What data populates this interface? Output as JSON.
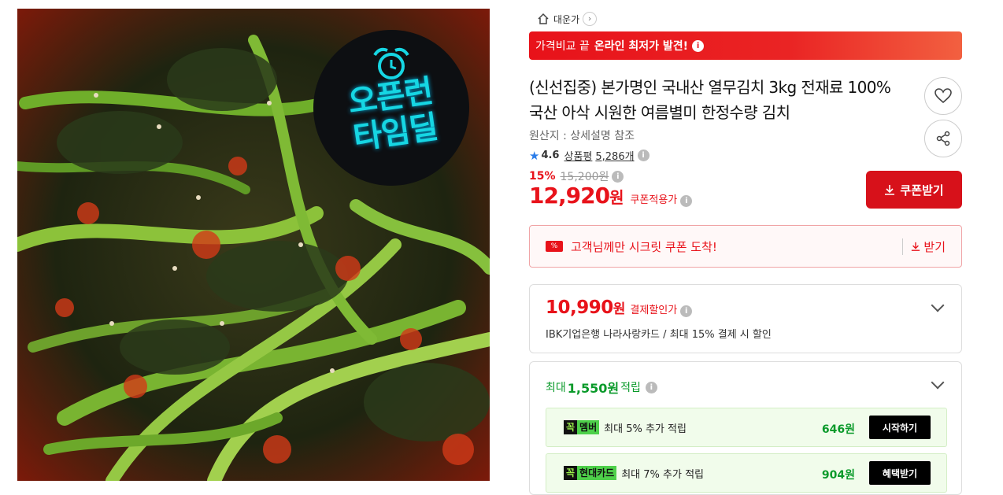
{
  "product_image": {
    "badge_line1": "오픈런",
    "badge_line2": "타임딜",
    "alarm_icon": "alarm-clock-icon"
  },
  "store": {
    "name": "대운가",
    "chevron": "›"
  },
  "banner": {
    "text": "가격비교 끝",
    "bold": "온라인 최저가 발견!",
    "info": "i"
  },
  "product": {
    "title": "(신선집중) 본가명인 국내산 열무김치 3kg 전재료 100% 국산 아삭 시원한 여름별미 한정수량 김치",
    "origin": "원산지 : 상세설명 참조",
    "rating": "4.6",
    "review_label": "상품평",
    "review_count": "5,286개",
    "discount_pct": "15%",
    "original_price": "15,200원",
    "price": "12,920",
    "price_unit": "원",
    "price_label": "쿠폰적용가"
  },
  "coupon_button": "쿠폰받기",
  "secret_coupon": {
    "ticket": "%",
    "text": "고객님께만 시크릿 쿠폰 도착!",
    "get_label": "받기"
  },
  "card_discount": {
    "price": "10,990",
    "unit": "원",
    "label": "결제할인가",
    "desc": "IBK기업은행 나라사랑카드 / 최대 15% 결제 시 할인"
  },
  "reward": {
    "prefix": "최대",
    "amount": "1,550원",
    "suffix": "적립",
    "rows": [
      {
        "tag_k": "꼭",
        "tag": "멤버",
        "text": "최대 5% 추가 적립",
        "amount": "646원",
        "button": "시작하기"
      },
      {
        "tag_k": "꼭",
        "tag": "현대카드",
        "text": "최대 7% 추가 적립",
        "amount": "904원",
        "button": "혜택받기"
      }
    ]
  },
  "colors": {
    "accent": "#e8121a",
    "green": "#0a9a2a",
    "badge_cyan": "#16d6e3"
  }
}
